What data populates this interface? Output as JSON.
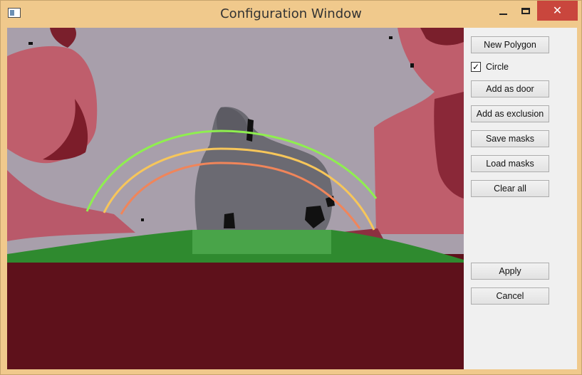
{
  "window": {
    "title": "Configuration Window"
  },
  "titlebar_buttons": {
    "minimize_icon": "minimize-icon",
    "maximize_icon": "maximize-icon",
    "close_icon": "close-icon"
  },
  "sidebar": {
    "new_polygon": "New Polygon",
    "circle_label": "Circle",
    "circle_checked": true,
    "add_door": "Add as door",
    "add_exclusion": "Add as exclusion",
    "save_masks": "Save masks",
    "load_masks": "Load masks",
    "clear_all": "Clear all",
    "apply": "Apply",
    "cancel": "Cancel"
  },
  "colors": {
    "titlebar": "#f0c98c",
    "close_button": "#c9463d",
    "mask_red": "#5e111b",
    "floor_green": "#2f8a2f",
    "arc_green": "#8fef4f",
    "arc_yellow": "#f7c65a",
    "arc_orange": "#f0855a"
  }
}
